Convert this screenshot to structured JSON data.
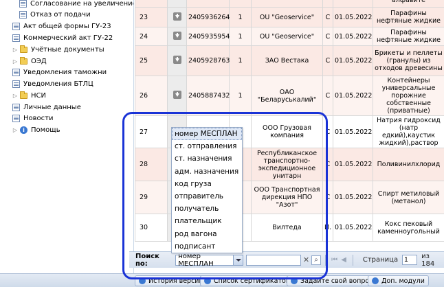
{
  "sidebar": {
    "items": [
      {
        "label": "Согласование на увеличение по",
        "icon": "document-icon",
        "expandable": false
      },
      {
        "label": "Отказ от подачи",
        "icon": "document-icon",
        "expandable": false
      },
      {
        "label": "Акт общей формы ГУ-23",
        "icon": "document-icon",
        "expandable": false
      },
      {
        "label": "Коммерческий акт ГУ-22",
        "icon": "document-icon",
        "expandable": false
      },
      {
        "label": "Учётные документы",
        "icon": "folder-icon",
        "expandable": true
      },
      {
        "label": "ОЭД",
        "icon": "folder-icon",
        "expandable": true
      },
      {
        "label": "Уведомления таможни",
        "icon": "document-icon",
        "expandable": false
      },
      {
        "label": "Уведомления БТЛЦ",
        "icon": "document-icon",
        "expandable": false
      },
      {
        "label": "НСИ",
        "icon": "folder-icon",
        "expandable": true
      },
      {
        "label": "Личные данные",
        "icon": "document-icon",
        "expandable": false
      },
      {
        "label": "Новости",
        "icon": "document-icon",
        "expandable": false
      },
      {
        "label": "Помощь",
        "icon": "info-icon",
        "expandable": true
      }
    ]
  },
  "grid": {
    "top_partial_text": "алфавите",
    "rows": [
      {
        "num": "23",
        "id": "2405936264",
        "qty": "1",
        "org": "OU \"Geoservice\"",
        "type": "С",
        "date": "01.05.2022",
        "cargo": "Парафины нефтяные жидкие"
      },
      {
        "num": "24",
        "id": "2405935954",
        "qty": "1",
        "org": "OU \"Geoservice\"",
        "type": "С",
        "date": "01.05.2022",
        "cargo": "Парафины нефтяные жидкие"
      },
      {
        "num": "25",
        "id": "2405928763",
        "qty": "1",
        "org": "ЗАО Вестака",
        "type": "С",
        "date": "01.05.2022",
        "cargo": "Брикеты и пеллеты (гранулы) из отходов древесины"
      },
      {
        "num": "26",
        "id": "2405887432",
        "qty": "1",
        "org": "ОАО \"Беларуськалий\"",
        "type": "С",
        "date": "01.05.2022",
        "cargo": "Контейнеры универсальные порожние собственные (приватные)"
      },
      {
        "num": "27",
        "id": "",
        "qty": "",
        "org": "ООО Грузовая компания",
        "type": "С",
        "date": "01.05.2022",
        "cargo": "Натрия гидроксид (натр едкий),каустик жидкий),раствор"
      },
      {
        "num": "28",
        "id": "",
        "qty": "",
        "org": "Республиканское транспортно-экспедиционное унитарн",
        "type": "С",
        "date": "01.05.2022",
        "cargo": "Поливинилхлорид"
      },
      {
        "num": "29",
        "id": "",
        "qty": "",
        "org": "ООО Транспортная дирекция НПО \"Азот\"",
        "type": "С",
        "date": "01.05.2022",
        "cargo": "Спирт метиловый (метанол)"
      },
      {
        "num": "30",
        "id": "",
        "qty": "",
        "org": "Вилтеда",
        "type": "И.",
        "date": "01.05.2022",
        "cargo": "Кокс пековый каменноугольный"
      }
    ]
  },
  "dropdown": {
    "options": [
      "номер МЕСПЛАН",
      "ст. отправления",
      "ст. назначения",
      "адм. назначения",
      "код груза",
      "отправитель",
      "получатель",
      "плательщик",
      "род вагона",
      "подписант"
    ],
    "selected_index": 0
  },
  "toolbar": {
    "search_label": "Поиск по:",
    "selected_field": "номер МЕСПЛАН",
    "search_value": "",
    "page_label": "Страница",
    "page_value": "1",
    "page_total": "из 184"
  },
  "bottom_bar": {
    "buttons": [
      "История версий",
      "Список сертификатов",
      "Задайте свой вопрос",
      "Доп. модули"
    ]
  },
  "colors": {
    "highlight": "#1a33d6",
    "row_odd": "#fbe9e4",
    "row_even": "#fdf3f0"
  }
}
